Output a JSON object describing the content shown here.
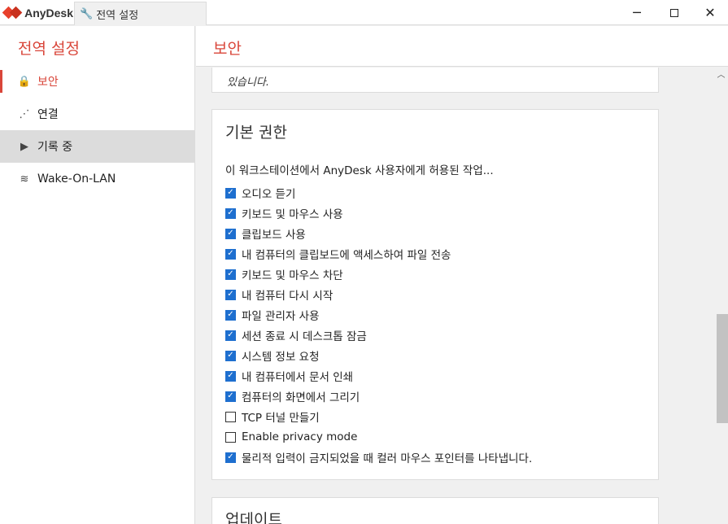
{
  "app": {
    "name": "AnyDesk"
  },
  "tab": {
    "label": "전역 설정",
    "icon": "wrench-icon"
  },
  "window_controls": {
    "minimize": "─",
    "close": "✕"
  },
  "sidebar": {
    "title": "전역 설정",
    "items": [
      {
        "label": "보안",
        "icon": "lock-icon",
        "glyph": "🔒",
        "active": true
      },
      {
        "label": "연결",
        "icon": "connection-icon",
        "glyph": "⋰"
      },
      {
        "label": "기록 중",
        "icon": "recording-icon",
        "glyph": "▶"
      },
      {
        "label": "Wake-On-LAN",
        "icon": "wifi-icon",
        "glyph": "≋"
      }
    ]
  },
  "header": {
    "title": "보안"
  },
  "prev_card": {
    "tail_text": "있습니다."
  },
  "permissions": {
    "title": "기본 권한",
    "description": "이 워크스테이션에서 AnyDesk 사용자에게 허용된 작업...",
    "items": [
      {
        "label": "오디오 듣기",
        "checked": true
      },
      {
        "label": "키보드 및 마우스 사용",
        "checked": true
      },
      {
        "label": "클립보드 사용",
        "checked": true
      },
      {
        "label": "내 컴퓨터의 클립보드에 액세스하여 파일 전송",
        "checked": true
      },
      {
        "label": "키보드 및 마우스 차단",
        "checked": true
      },
      {
        "label": "내 컴퓨터 다시 시작",
        "checked": true
      },
      {
        "label": "파일 관리자 사용",
        "checked": true
      },
      {
        "label": "세션 종료 시 데스크톱 잠금",
        "checked": true
      },
      {
        "label": "시스템 정보 요청",
        "checked": true
      },
      {
        "label": "내 컴퓨터에서 문서 인쇄",
        "checked": true
      },
      {
        "label": "컴퓨터의 화면에서 그리기",
        "checked": true
      },
      {
        "label": "TCP 터널 만들기",
        "checked": false
      },
      {
        "label": "Enable privacy mode",
        "checked": false
      },
      {
        "label": "물리적 입력이 금지되었을 때 컬러 마우스 포인터를 나타냅니다.",
        "checked": true
      }
    ]
  },
  "updates": {
    "title": "업데이트"
  },
  "colors": {
    "accent": "#d9463a",
    "checkbox": "#1e6fcf"
  }
}
